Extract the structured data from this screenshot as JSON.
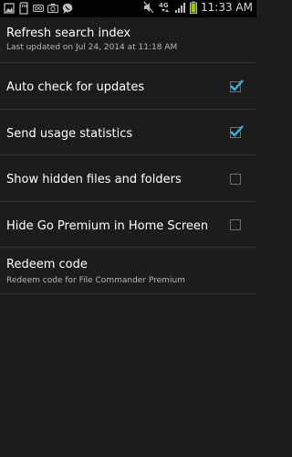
{
  "status_bar": {
    "time": "11:33 AM",
    "left_icons": [
      "gallery-icon",
      "sd-card-icon",
      "voicemail-icon",
      "camera-icon",
      "chat-icon"
    ],
    "right_icons": [
      "mute-icon",
      "4g-icon",
      "signal-icon",
      "battery-icon"
    ],
    "network_label": "4G"
  },
  "settings": [
    {
      "title": "Refresh search index",
      "summary": "Last updated on Jul 24, 2014 at 11:18 AM"
    },
    {
      "title": "Auto check for updates",
      "checked": true
    },
    {
      "title": "Send usage statistics",
      "checked": true
    },
    {
      "title": "Show hidden files and folders",
      "checked": false
    },
    {
      "title": "Hide Go Premium in Home Screen",
      "checked": false
    },
    {
      "title": "Redeem code",
      "summary": "Redeem code for File Commander Premium"
    }
  ],
  "colors": {
    "background": "#1c1c1c",
    "divider": "#333333",
    "accent": "#33b5e5",
    "battery": "#99cc00"
  }
}
